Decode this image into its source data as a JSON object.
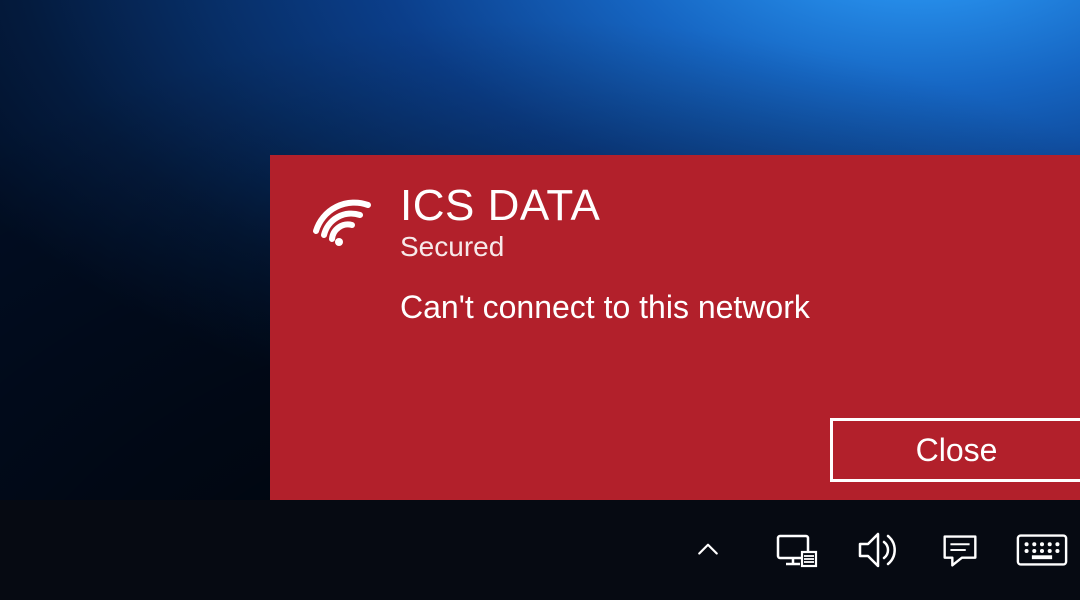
{
  "network": {
    "name": "ICS DATA",
    "security": "Secured",
    "error": "Can't connect to this network",
    "close_label": "Close"
  },
  "icons": {
    "wifi": "wifi-icon",
    "tray_overflow": "chevron-up-icon",
    "network": "network-monitor-icon",
    "volume": "speaker-icon",
    "action_center": "action-center-icon",
    "touch_keyboard": "touch-keyboard-icon"
  },
  "colors": {
    "panel": "#b2202b",
    "taskbar": "#060a12",
    "text": "#ffffff"
  }
}
